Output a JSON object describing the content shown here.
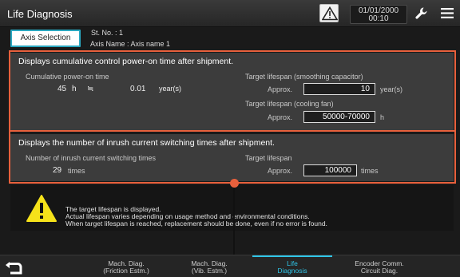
{
  "header": {
    "title": "Life Diagnosis",
    "date": "01/01/2000",
    "time": "00:10",
    "icons": [
      "warning-triangle-icon",
      "wrench-icon",
      "hamburger-menu-icon"
    ]
  },
  "axis": {
    "button_label": "Axis Selection",
    "station": "St. No. :   1",
    "axis_name": "Axis Name : Axis name 1"
  },
  "power_on": {
    "heading": "Displays cumulative control power-on time after shipment.",
    "cumulative_label": "Cumulative power-on time",
    "hours": "45",
    "hours_unit": "h",
    "approx_sign": "≒",
    "years": "0.01",
    "years_unit": "year(s)",
    "capacitor_label": "Target lifespan (smoothing capacitor)",
    "approx_label": "Approx.",
    "capacitor_value": "10",
    "capacitor_unit": "year(s)",
    "fan_label": "Target lifespan (cooling fan)",
    "fan_approx_label": "Approx.",
    "fan_value": "50000-70000",
    "fan_unit": "h"
  },
  "inrush": {
    "heading": "Displays the number of inrush current switching times after shipment.",
    "count_label": "Number of inrush current switching times",
    "count": "29",
    "count_unit": "times",
    "target_label": "Target lifespan",
    "approx_label": "Approx.",
    "target_value": "100000",
    "target_unit": "times"
  },
  "notice": {
    "lines": [
      "The target lifespan is displayed.",
      "Actual lifespan varies depending on usage method and environmental conditions.",
      "When target lifespan is reached, replacement should be done, even if no error is found."
    ]
  },
  "tabs": [
    {
      "line1": "Mach. Diag.",
      "line2": "(Friction Estm.)"
    },
    {
      "line1": "Mach. Diag.",
      "line2": "(Vib. Estm.)"
    },
    {
      "line1": "Life",
      "line2": "Diagnosis"
    },
    {
      "line1": "Encoder Comm.",
      "line2": "Circuit Diag."
    }
  ],
  "colors": {
    "accent": "#2fc5e8",
    "highlight": "#e8603c",
    "warning": "#f5e21a"
  }
}
